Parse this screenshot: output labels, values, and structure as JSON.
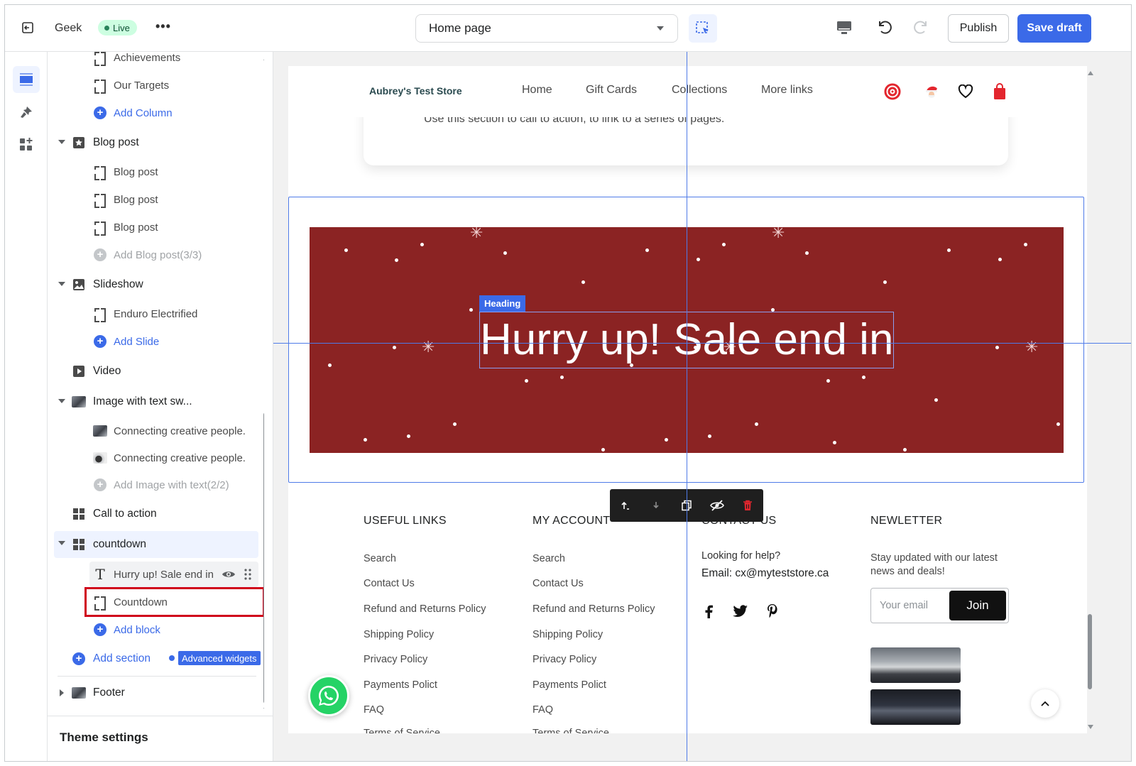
{
  "topbar": {
    "store_name": "Geek",
    "status": "Live",
    "page_selector": "Home page",
    "publish_label": "Publish",
    "save_label": "Save draft"
  },
  "sidebar": {
    "partial_top": "Achievements",
    "our_targets": "Our Targets",
    "add_column": "Add Column",
    "blog_section": "Blog post",
    "blog_items": [
      "Blog post",
      "Blog post",
      "Blog post"
    ],
    "add_blog": "Add Blog post(3/3)",
    "slideshow": "Slideshow",
    "slide_item": "Enduro Electrified",
    "add_slide": "Add Slide",
    "video": "Video",
    "image_text": "Image with text sw...",
    "image_text_items": [
      "Connecting creative people.",
      "Connecting creative people."
    ],
    "add_image_text": "Add Image with text(2/2)",
    "call_to_action": "Call to action",
    "countdown": "countdown",
    "heading_block": "Hurry up! Sale end in",
    "countdown_block": "Countdown",
    "add_block": "Add block",
    "add_section": "Add section",
    "advanced_widgets": "Advanced widgets",
    "footer": "Footer",
    "theme_settings": "Theme settings"
  },
  "preview": {
    "store_logo": "Aubrey's Test Store",
    "nav": [
      "Home",
      "Gift Cards",
      "Collections",
      "More links"
    ],
    "cta_text": "Use this section to call to action, to link to a series of pages.",
    "heading_tag": "Heading",
    "banner_heading": "Hurry up! Sale end in",
    "banner_color": "#8b2323",
    "footer": {
      "col1_title": "USEFUL LINKS",
      "col1_links": [
        "Search",
        "Contact Us",
        "Refund and Returns Policy",
        "Shipping Policy",
        "Privacy Policy",
        "Payments Polict",
        "FAQ",
        "Terms of Service"
      ],
      "col2_title": "MY ACCOUNT",
      "col2_links": [
        "Search",
        "Contact Us",
        "Refund and Returns Policy",
        "Shipping Policy",
        "Privacy Policy",
        "Payments Polict",
        "FAQ",
        "Terms of Service"
      ],
      "col3_title": "CONTACT US",
      "help_text": "Looking for help?",
      "email_label": "Email:",
      "email": "cx@myteststore.ca",
      "col4_title": "NEWLETTER",
      "newsletter_text": "Stay updated with our latest news and deals!",
      "email_placeholder": "Your email",
      "join_label": "Join"
    }
  },
  "colors": {
    "accent": "#3b6ae8",
    "live_bg": "#cdfee1",
    "highlight": "#d0021b"
  }
}
